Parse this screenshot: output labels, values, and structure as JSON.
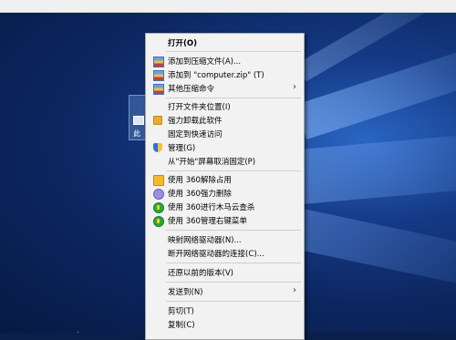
{
  "desktop": {
    "icon_label": "此"
  },
  "context_menu": {
    "items": [
      {
        "label": "打开(O)",
        "bold": true,
        "icon": "none"
      },
      {
        "label": "添加到压缩文件(A)...",
        "icon": "winrar-archive-icon"
      },
      {
        "label": "添加到 \"computer.zip\" (T)",
        "icon": "winrar-archive-icon"
      },
      {
        "label": "其他压缩命令",
        "icon": "winrar-archive-icon",
        "submenu": true
      },
      {
        "label": "打开文件夹位置(I)",
        "icon": "none"
      },
      {
        "label": "强力卸载此软件",
        "icon": "uninstall-icon"
      },
      {
        "label": "固定到快速访问",
        "icon": "none"
      },
      {
        "label": "管理(G)",
        "icon": "admin-shield-icon"
      },
      {
        "label": "从\"开始\"屏幕取消固定(P)",
        "icon": "none"
      },
      {
        "label": "使用 360解除占用",
        "icon": "360-unlock-icon"
      },
      {
        "label": "使用 360强力删除",
        "icon": "360-delete-icon"
      },
      {
        "label": "使用 360进行木马云查杀",
        "icon": "360-scan-icon"
      },
      {
        "label": "使用 360管理右键菜单",
        "icon": "360-menu-icon"
      },
      {
        "label": "映射网络驱动器(N)...",
        "icon": "none"
      },
      {
        "label": "断开网络驱动器的连接(C)...",
        "icon": "none"
      },
      {
        "label": "还原以前的版本(V)",
        "icon": "none"
      },
      {
        "label": "发送到(N)",
        "icon": "none",
        "submenu": true
      },
      {
        "label": "剪切(T)",
        "icon": "none"
      },
      {
        "label": "复制(C)",
        "icon": "none"
      }
    ],
    "submenu_arrow": "›"
  }
}
